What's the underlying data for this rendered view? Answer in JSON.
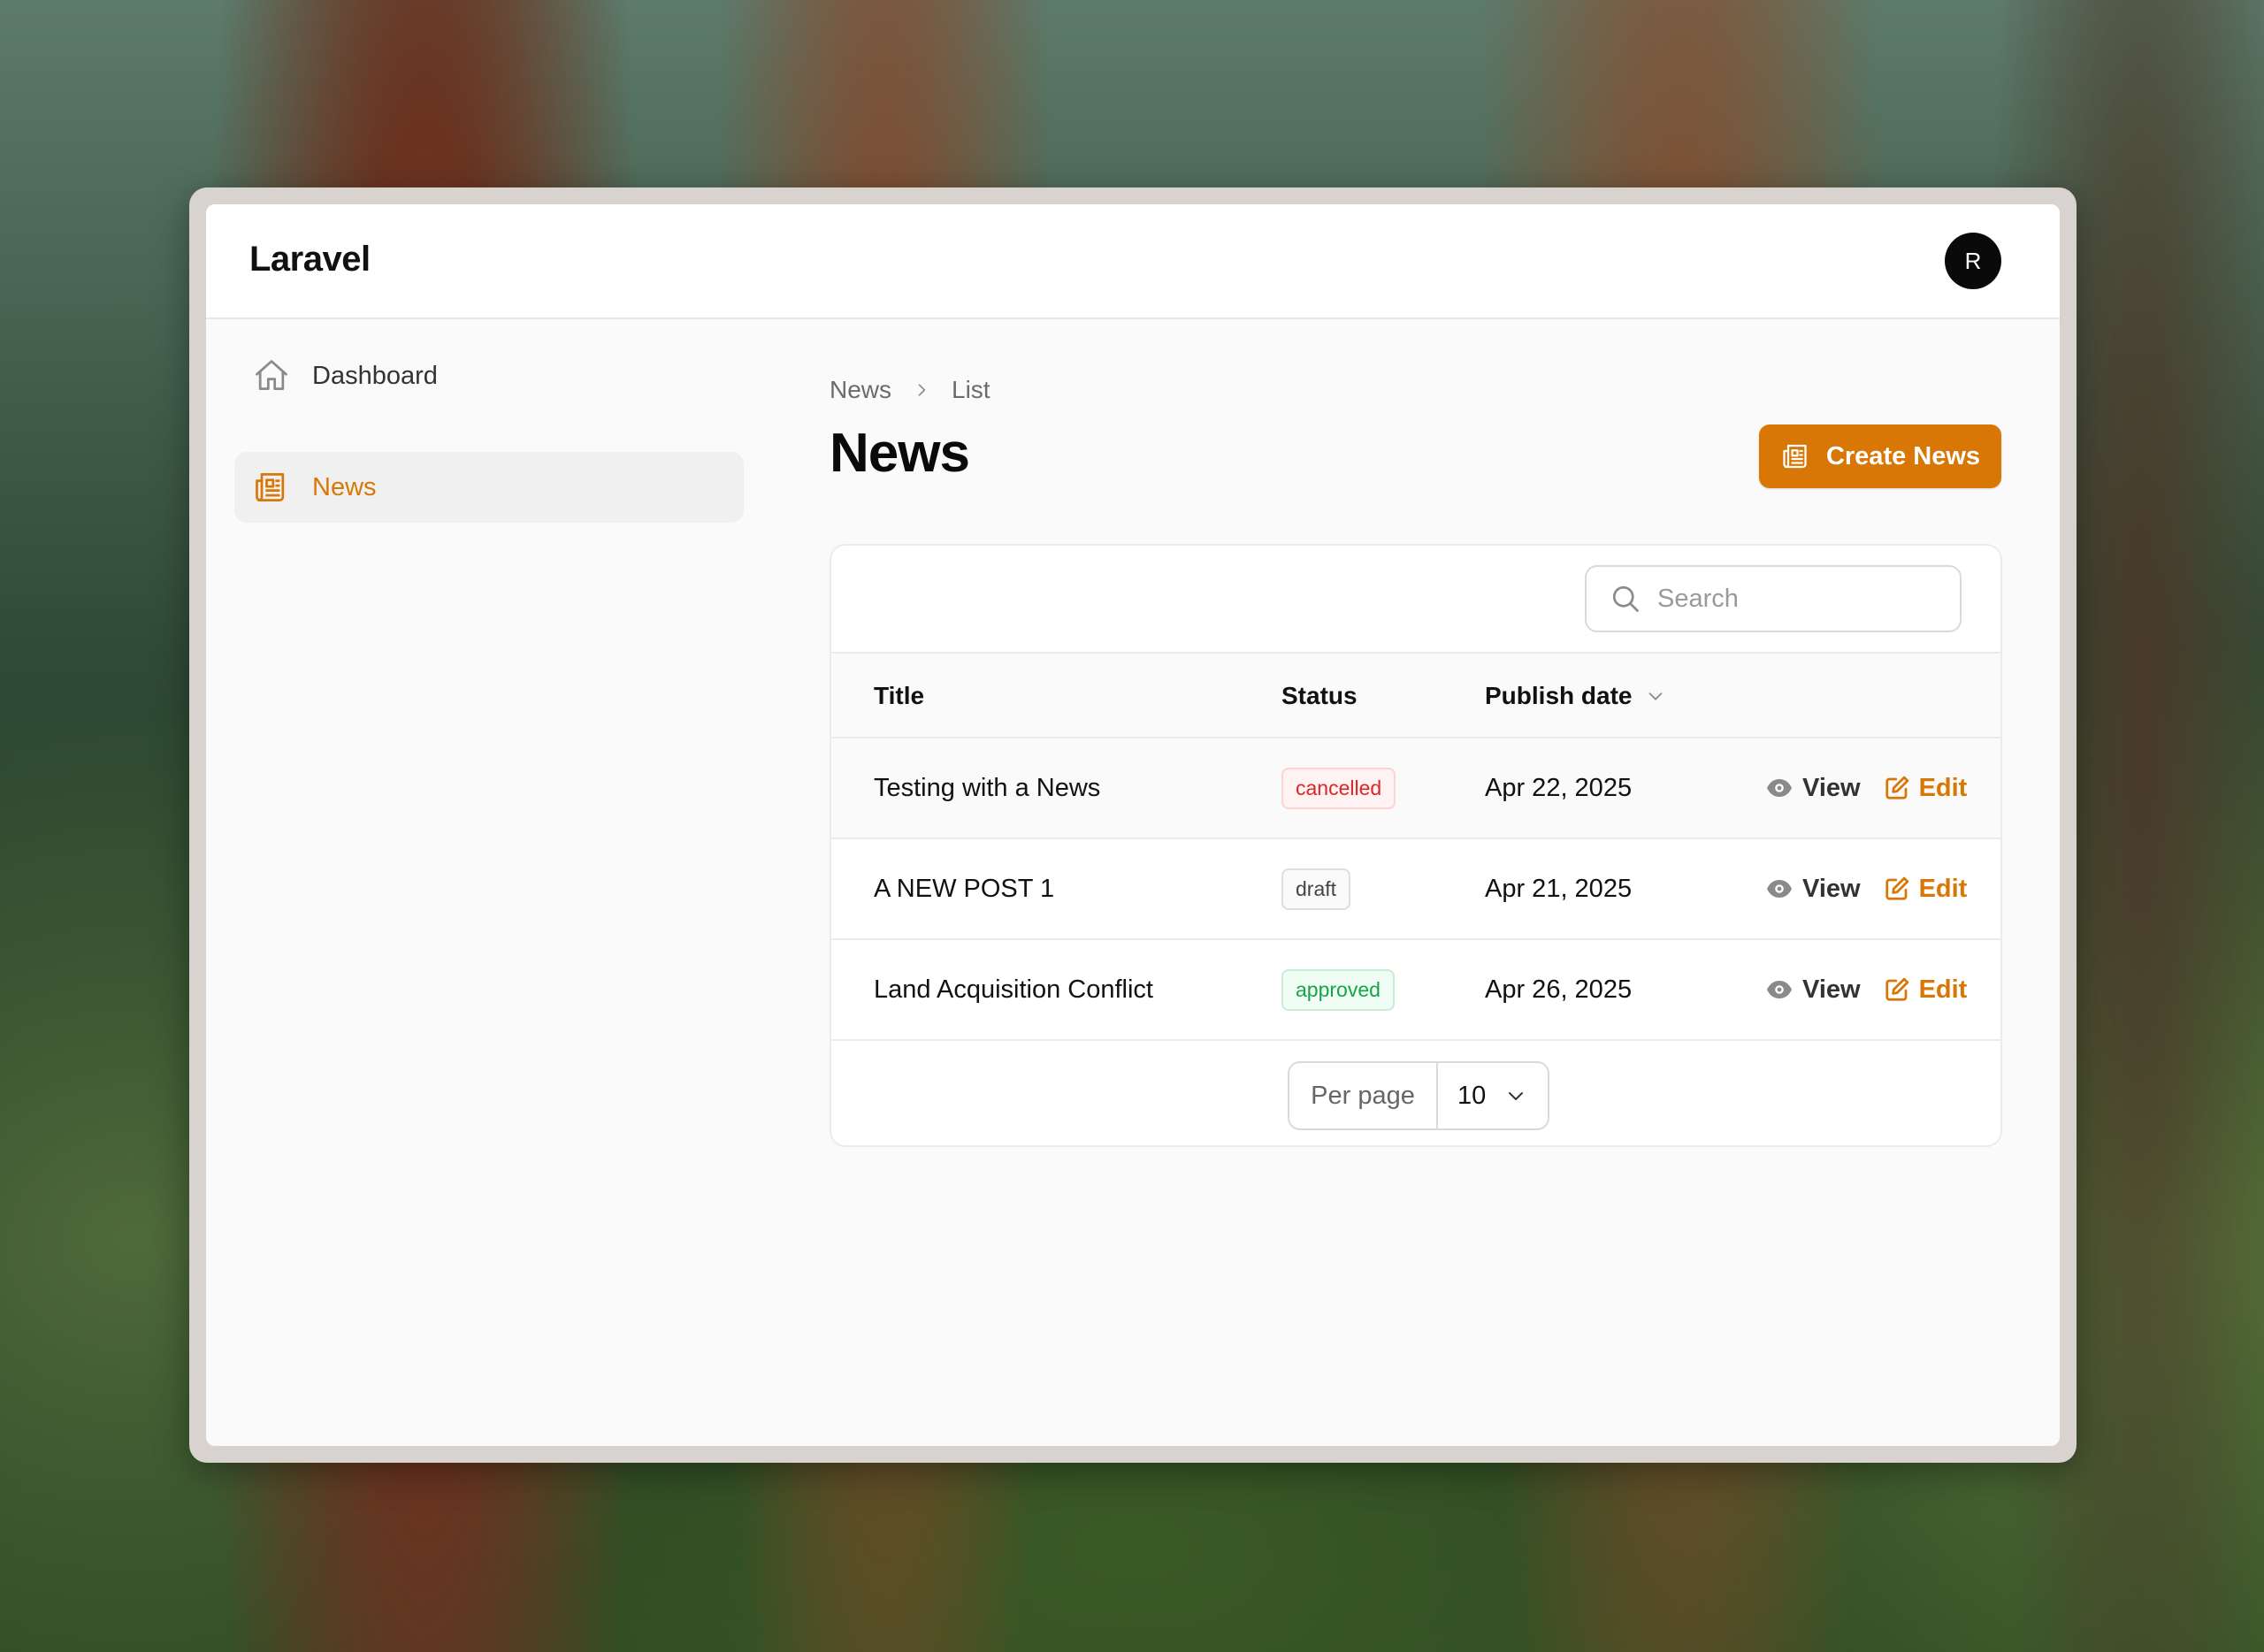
{
  "app": {
    "brand": "Laravel",
    "avatar_initial": "R"
  },
  "sidebar": {
    "items": [
      {
        "label": "Dashboard",
        "icon": "home-icon",
        "active": false
      },
      {
        "label": "News",
        "icon": "newspaper-icon",
        "active": true
      }
    ]
  },
  "breadcrumb": {
    "parent": "News",
    "current": "List"
  },
  "page": {
    "title": "News",
    "create_label": "Create News"
  },
  "table": {
    "search_placeholder": "Search",
    "columns": {
      "title": "Title",
      "status": "Status",
      "publish_date": "Publish date"
    },
    "rows": [
      {
        "title": "Testing with a News",
        "status": "cancelled",
        "date": "Apr 22, 2025",
        "view": "View",
        "edit": "Edit"
      },
      {
        "title": "A NEW POST 1",
        "status": "draft",
        "date": "Apr 21, 2025",
        "view": "View",
        "edit": "Edit"
      },
      {
        "title": "Land Acquisition Conflict",
        "status": "approved",
        "date": "Apr 26, 2025",
        "view": "View",
        "edit": "Edit"
      }
    ],
    "pagination": {
      "per_page_label": "Per page",
      "per_page_value": "10"
    }
  },
  "colors": {
    "accent": "#d97706",
    "cancelled": "#dc2626",
    "approved": "#16a34a"
  }
}
